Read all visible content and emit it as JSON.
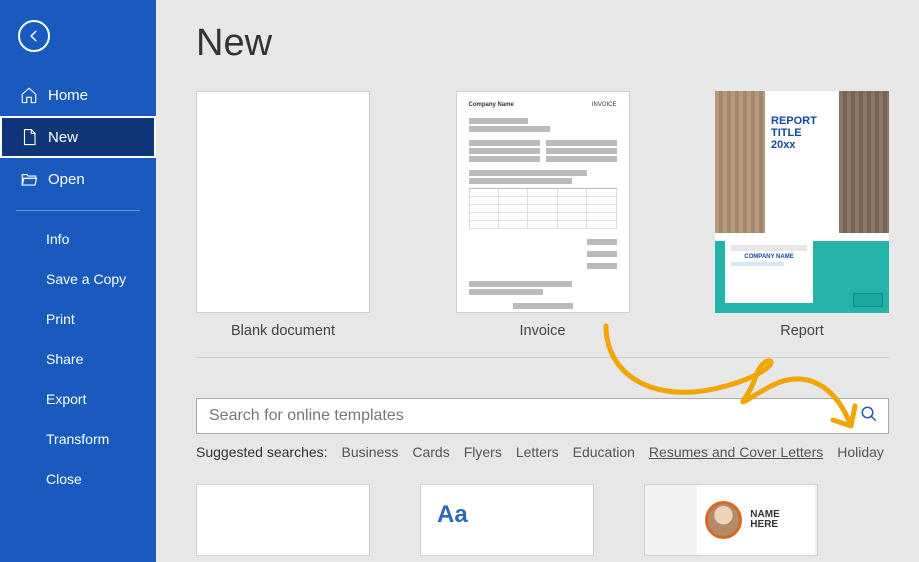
{
  "sidebar": {
    "primary": [
      {
        "label": "Home"
      },
      {
        "label": "New"
      },
      {
        "label": "Open"
      }
    ],
    "secondary": [
      "Info",
      "Save a Copy",
      "Print",
      "Share",
      "Export",
      "Transform",
      "Close"
    ]
  },
  "page_title": "New",
  "templates": [
    {
      "label": "Blank document"
    },
    {
      "label": "Invoice"
    },
    {
      "label": "Report",
      "title_text": "REPORT TITLE",
      "subtitle_text": "20xx"
    }
  ],
  "search": {
    "placeholder": "Search for online templates"
  },
  "suggest_label": "Suggested searches:",
  "suggest_items": [
    "Business",
    "Cards",
    "Flyers",
    "Letters",
    "Education",
    "Resumes and Cover Letters",
    "Holiday"
  ],
  "row2": {
    "aa": "Aa",
    "resume_name": "NAME HERE"
  }
}
